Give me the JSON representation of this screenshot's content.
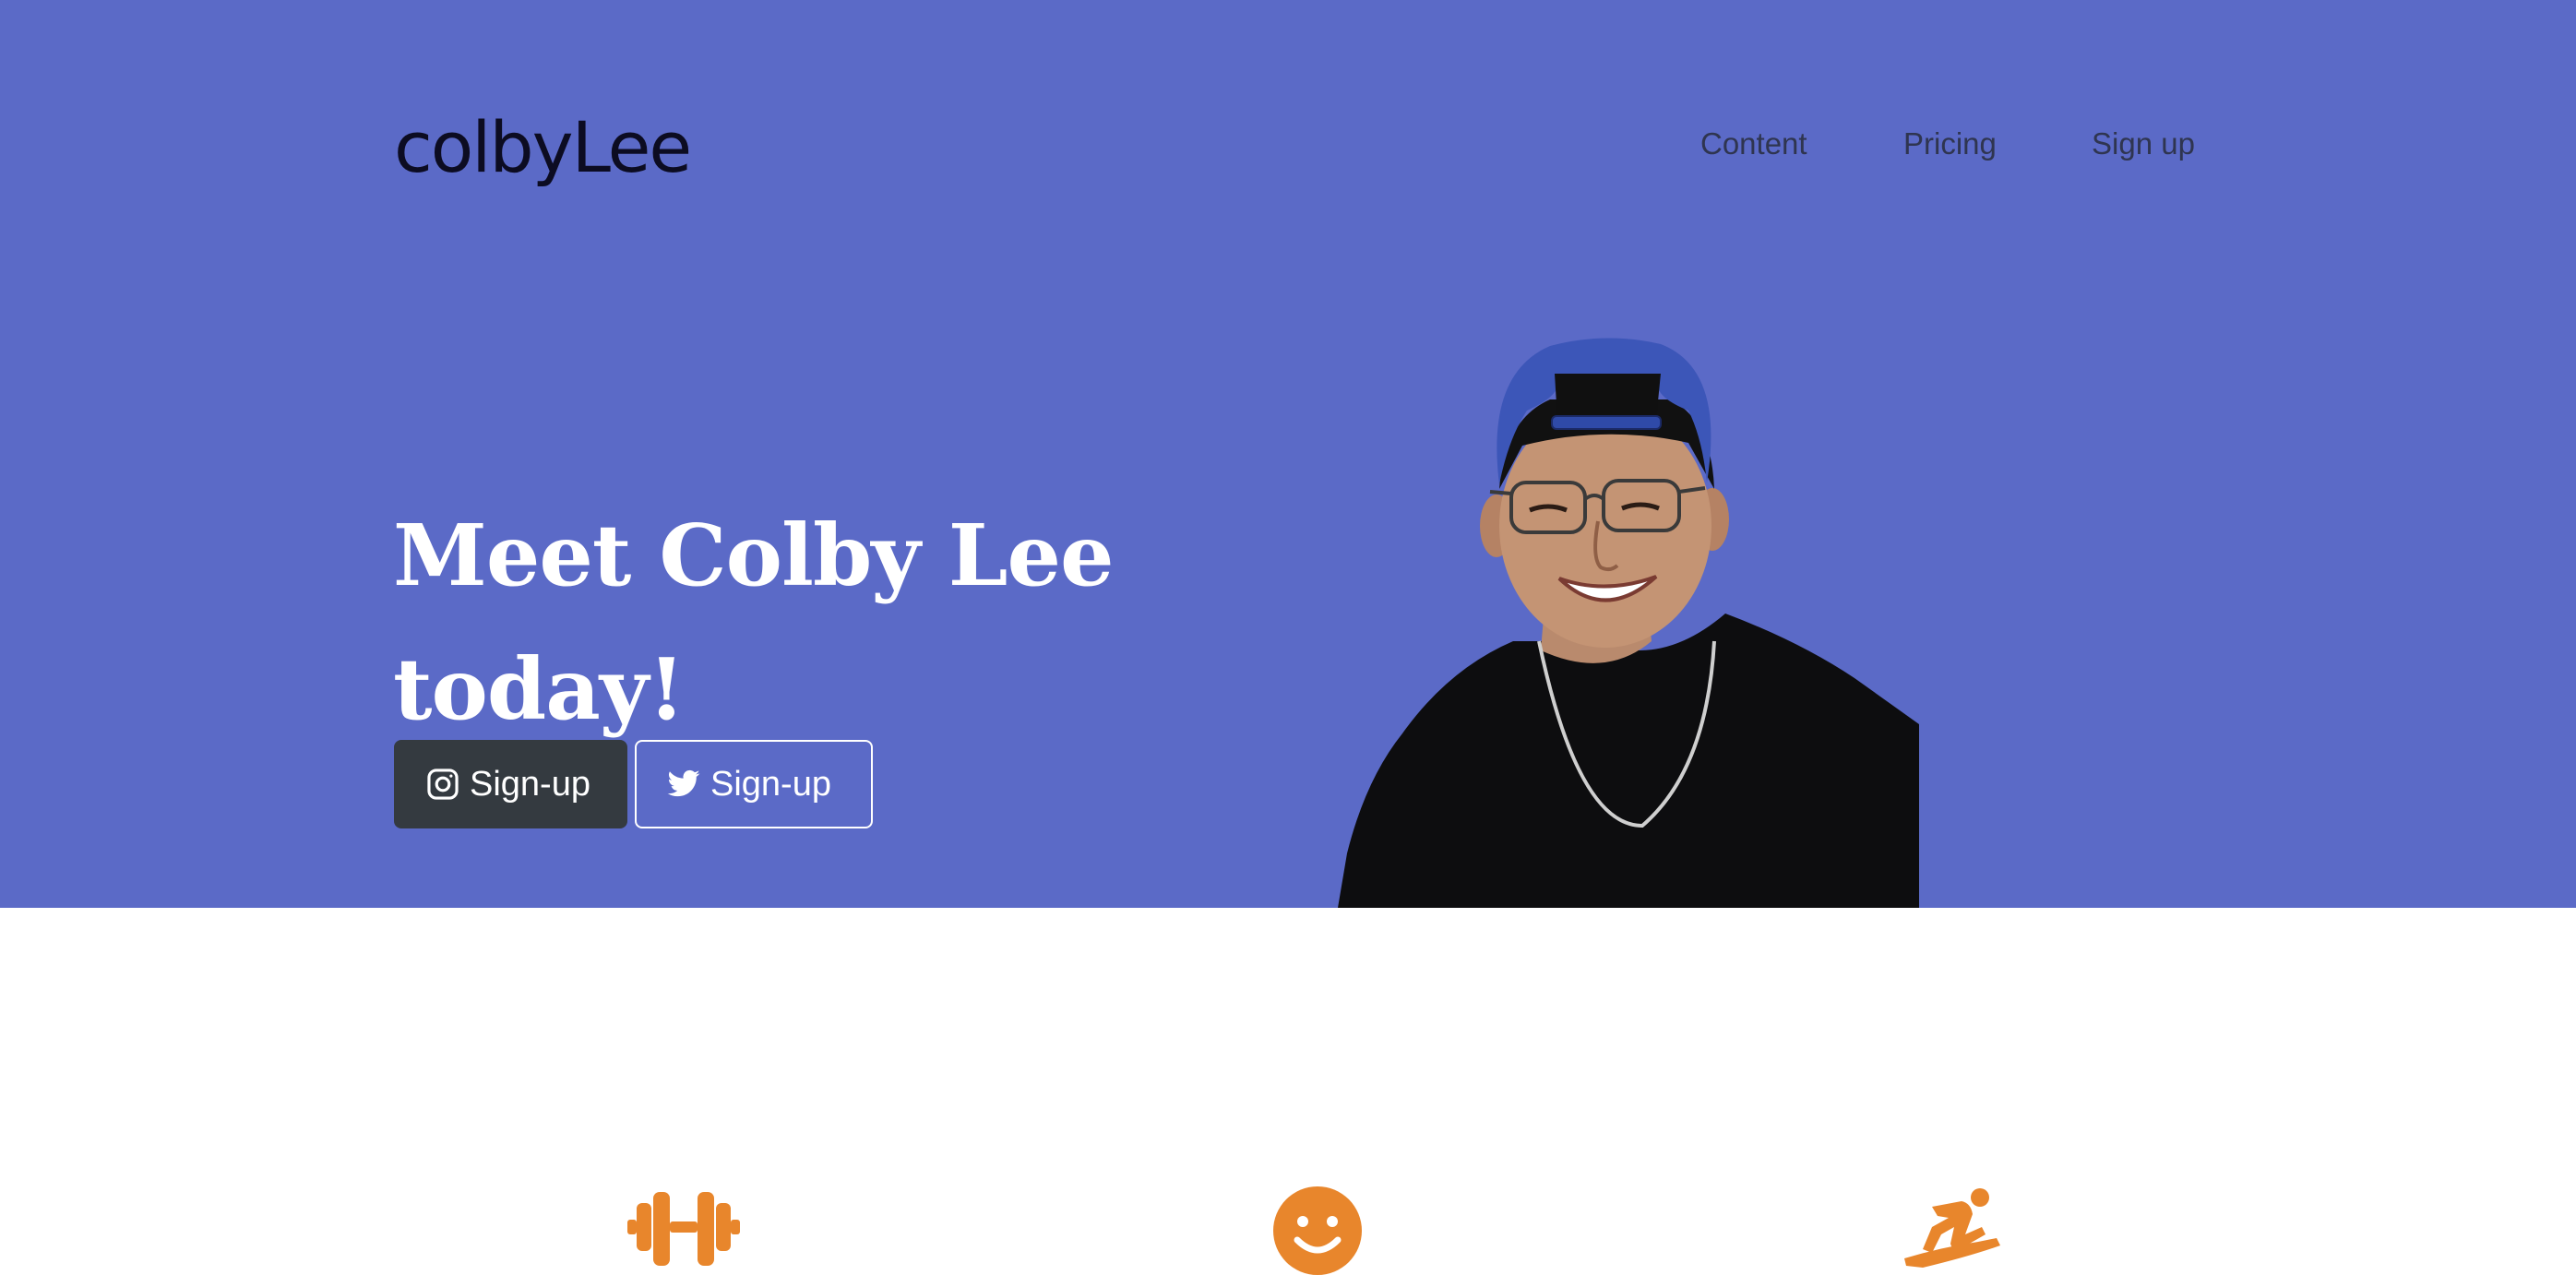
{
  "header": {
    "brand": "colbyLee",
    "nav": [
      {
        "label": "Content"
      },
      {
        "label": "Pricing"
      },
      {
        "label": "Sign up"
      }
    ]
  },
  "hero": {
    "headline": "Meet Colby Lee today!",
    "buttons": [
      {
        "label": "Sign-up",
        "icon": "instagram-icon"
      },
      {
        "label": "Sign-up",
        "icon": "twitter-icon"
      }
    ],
    "image": "portrait"
  },
  "features": {
    "icons": [
      "dumbbell-icon",
      "smile-icon",
      "snowboarding-icon"
    ]
  },
  "colors": {
    "hero_bg": "#5b6ac7",
    "accent": "#e8862c",
    "dark_button": "#343a40"
  }
}
